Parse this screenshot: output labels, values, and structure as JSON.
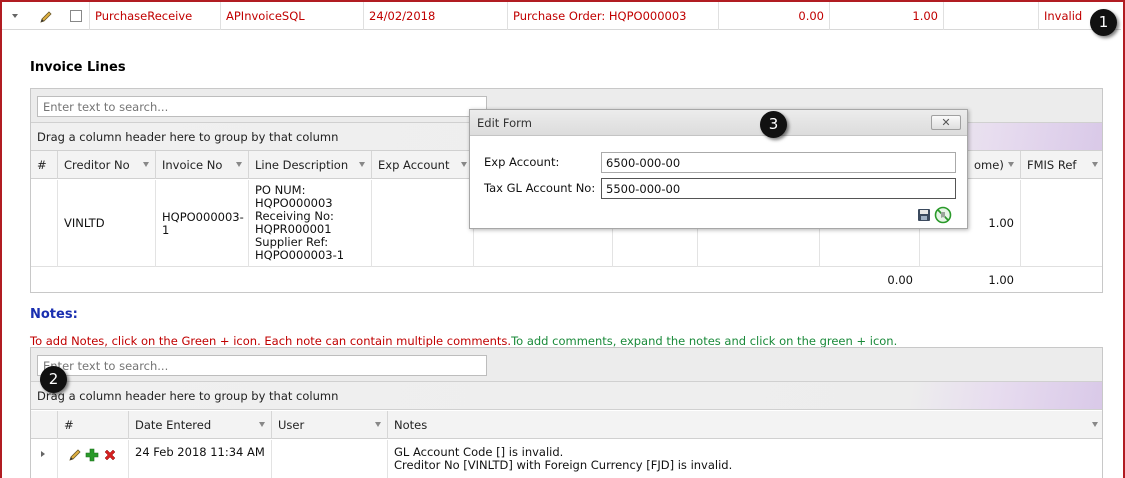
{
  "top_row": {
    "source": "PurchaseReceive",
    "process": "APInvoiceSQL",
    "date": "24/02/2018",
    "reference": "Purchase Order: HQPO000003",
    "amount1": "0.00",
    "amount2": "1.00",
    "status": "Invalid"
  },
  "callouts": [
    "1",
    "2",
    "3"
  ],
  "invoice_lines": {
    "title": "Invoice Lines",
    "search_placeholder": "Enter text to search...",
    "group_hint": "Drag a column header here to group by that column",
    "columns": [
      "#",
      "Creditor No",
      "Invoice No",
      "Line Description",
      "Exp Account",
      "ome)",
      "FMIS Ref"
    ],
    "row": {
      "creditor_no": "VINLTD",
      "invoice_no_1": "HQPO000003-",
      "invoice_no_2": "1",
      "desc_lines": [
        "PO NUM:",
        "HQPO000003",
        "Receiving No:",
        "HQPR000001",
        "Supplier Ref:",
        "HQPO000003-1"
      ],
      "amount": "1.00"
    },
    "totals": [
      "0.00",
      "1.00"
    ]
  },
  "notes": {
    "title": "Notes:",
    "hint_red": "To add Notes, click on the Green + icon. Each note can contain multiple comments.",
    "hint_green": "To add comments, expand the notes and click on the green + icon.",
    "search_placeholder": "Enter text to search...",
    "group_hint": "Drag a column header here to group by that column",
    "columns": [
      "#",
      "Date Entered",
      "User",
      "Notes"
    ],
    "row": {
      "date": "24 Feb 2018 11:34 AM",
      "user": "",
      "note_line1": "GL Account Code [] is invalid.",
      "note_line2": "Creditor No [VINLTD] with Foreign Currency [FJD] is invalid."
    }
  },
  "edit_form": {
    "title": "Edit Form",
    "close_label": "✕",
    "fields": [
      {
        "label": "Exp Account:",
        "value": "6500-000-00"
      },
      {
        "label": "Tax GL Account No:",
        "value": "5500-000-00"
      }
    ]
  },
  "colors": {
    "frame_border": "#b11c22",
    "invalid_text": "#c00000",
    "notes_title": "#1a2fb0",
    "hint_green": "#1a8a3a",
    "add_icon": "#2a9a2a",
    "delete_icon": "#d42020"
  },
  "icons": [
    "expand-caret-icon",
    "edit-pencil-icon",
    "add-plus-icon",
    "delete-x-icon",
    "save-disk-icon",
    "cancel-icon",
    "filter-funnel-icon"
  ]
}
